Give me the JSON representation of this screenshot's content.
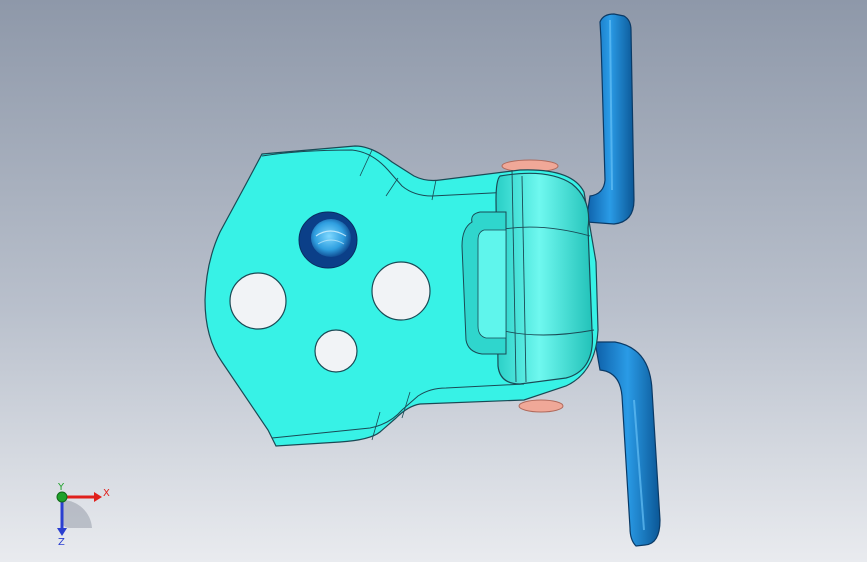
{
  "viewport": {
    "background_top": "#8e98a9",
    "background_bottom": "#e9ebef"
  },
  "model": {
    "plate_color": "#37f2e6",
    "leaf_color": "#1e8fd8",
    "pin_cap_color": "#f0a898",
    "edge_color": "#1a4a55"
  },
  "triad": {
    "x_label": "X",
    "y_label": "Y",
    "z_label": "Z",
    "x_color": "#e0201c",
    "y_color": "#1fa12a",
    "z_color": "#2a3fd0"
  }
}
